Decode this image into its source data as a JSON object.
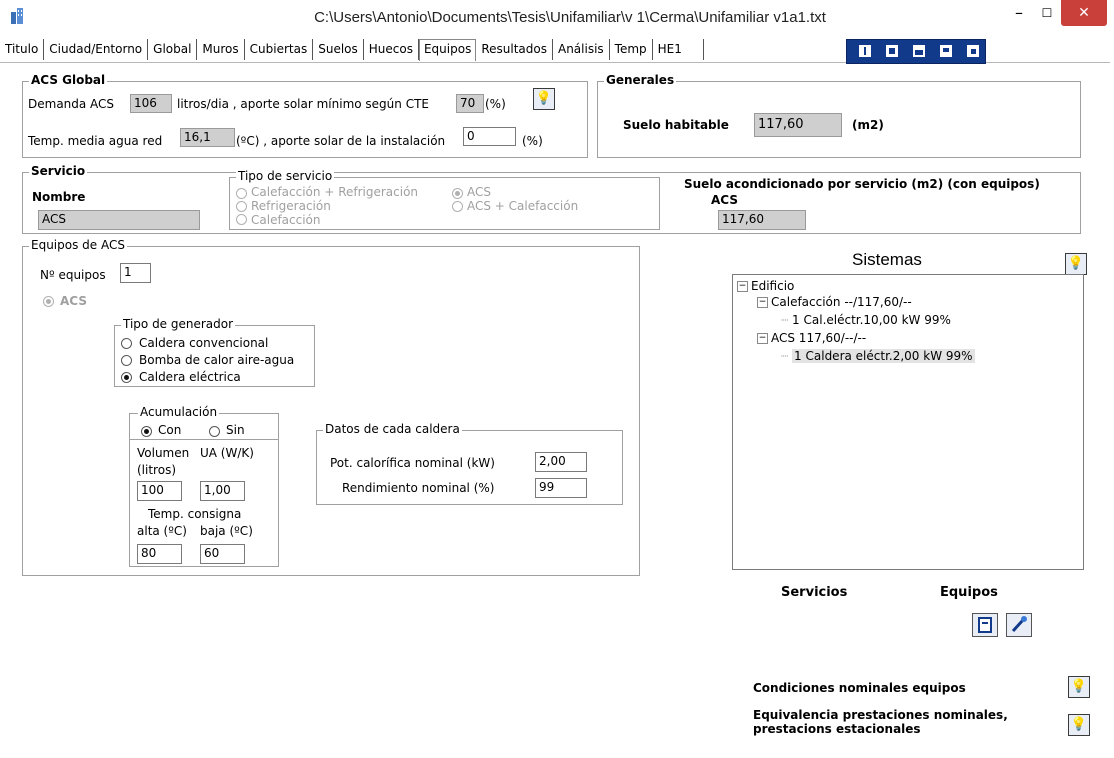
{
  "window": {
    "title": "C:\\Users\\Antonio\\Documents\\Tesis\\Unifamiliar\\v 1\\Cerma\\Unifamiliar v1a1.txt"
  },
  "tabs": [
    "Titulo",
    "Ciudad/Entorno",
    "Global",
    "Muros",
    "Cubiertas",
    "Suelos",
    "Huecos",
    "Equipos",
    "Resultados",
    "Análisis",
    "Temp",
    "HE1"
  ],
  "active_tab": "Equipos",
  "toolbar_icons": [
    "info-icon",
    "document-icon",
    "folder-icon",
    "save-icon",
    "copy-icon"
  ],
  "acs_global": {
    "title": "ACS Global",
    "demanda_label": "Demanda ACS",
    "demanda_value": "106",
    "litros_label": "litros/dia , aporte solar mínimo según CTE",
    "aporte_min_value": "70",
    "pct1": "(%)",
    "temp_label": "Temp. media agua red",
    "temp_value": "16,1",
    "temp_unit_label": "(ºC) , aporte solar de la instalación",
    "aporte_inst_value": "0",
    "pct2": "(%)"
  },
  "generales": {
    "title": "Generales",
    "suelo_label": "Suelo habitable",
    "suelo_value": "117,60",
    "unit": "(m2)"
  },
  "servicio": {
    "title": "Servicio",
    "nombre_label": "Nombre",
    "nombre_value": "ACS",
    "tipo_title": "Tipo de servicio",
    "options": [
      "Calefacción + Refrigeración",
      "Refrigeración",
      "Calefacción",
      "ACS",
      "ACS + Calefacción"
    ],
    "selected": "ACS",
    "suelo_acond_label": "Suelo acondicionado por servicio (m2)  (con equipos)",
    "acs_label": "ACS",
    "acs_value": "117,60"
  },
  "equipos_acs": {
    "title": "Equipos de ACS",
    "n_equipos_label": "Nº equipos",
    "n_equipos_value": "1",
    "acs_radio_label": "ACS",
    "generador_title": "Tipo de generador",
    "generador_options": [
      "Caldera convencional",
      "Bomba de calor aire-agua",
      "Caldera eléctrica"
    ],
    "generador_selected": "Caldera eléctrica",
    "acumulacion_title": "Acumulación",
    "con_label": "Con",
    "sin_label": "Sin",
    "acumulacion_selected": "Con",
    "volumen_label": "Volumen",
    "litros_label": "(litros)",
    "ua_label": "UA (W/K)",
    "volumen_value": "100",
    "ua_value": "1,00",
    "temp_consigna_label": "Temp. consigna",
    "alta_label": "alta (ºC)",
    "baja_label": "baja (ºC)",
    "alta_value": "80",
    "baja_value": "60",
    "datos_title": "Datos de cada caldera",
    "pot_label": "Pot. calorífica nominal (kW)",
    "pot_value": "2,00",
    "rend_label": "Rendimiento nominal (%)",
    "rend_value": "99"
  },
  "sistemas": {
    "title": "Sistemas",
    "tree": {
      "root": "Edificio",
      "calef": "Calefacción --/117,60/--",
      "calef_child": "1 Cal.eléctr.10,00 kW 99%",
      "acs": "ACS 117,60/--/--",
      "acs_child": "1 Caldera eléctr.2,00 kW 99%"
    }
  },
  "bottom": {
    "servicios_label": "Servicios",
    "equipos_label": "Equipos",
    "condiciones_label": "Condiciones nominales equipos",
    "equivalencia_label_1": "Equivalencia prestaciones nominales,",
    "equivalencia_label_2": "prestacions estacionales"
  }
}
